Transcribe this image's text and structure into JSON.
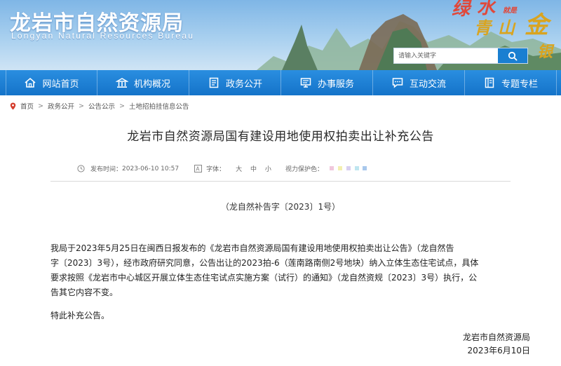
{
  "header": {
    "site_title": "龙岩市自然资源局",
    "site_subtitle": "Longyan Natural Resources Bureau",
    "slogan_chars": [
      "绿",
      "水",
      "就是",
      "青",
      "山",
      "金",
      "银"
    ],
    "search_placeholder": "请输入关键字"
  },
  "nav": {
    "items": [
      {
        "label": "网站首页",
        "icon": "home-icon"
      },
      {
        "label": "机构概况",
        "icon": "building-icon"
      },
      {
        "label": "政务公开",
        "icon": "document-icon"
      },
      {
        "label": "办事服务",
        "icon": "service-icon"
      },
      {
        "label": "互动交流",
        "icon": "chat-icon"
      },
      {
        "label": "专题专栏",
        "icon": "book-icon"
      }
    ]
  },
  "breadcrumb": {
    "items": [
      "首页",
      "政务公开",
      "公告公示",
      "土地招拍挂信息公告"
    ],
    "separator": ">"
  },
  "article": {
    "title": "龙岩市自然资源局国有建设用地使用权拍卖出让补充公告",
    "publish_label": "发布时间：",
    "publish_time": "2023-06-10 10:57",
    "font_label": "字体：",
    "font_sizes": [
      "大",
      "中",
      "小"
    ],
    "vision_label": "视力保护色：",
    "vision_colors": [
      "#f5e6ef",
      "#e6f5e6",
      "#f5f0e0",
      "#e0ecf5",
      "#ffffff"
    ],
    "doc_number": "（龙自然补告字〔2023〕1号）",
    "paragraph1_lines": [
      "我局于2023年5月25日在闽西日报发布的《龙岩市自然资源局国有建设用地使用权拍卖出让公告》（龙自然告",
      "字〔2023〕3号），经市政府研究同意，公告出让的2023拍-6（莲南路南侧2号地块）纳入立体生态住宅试点，具体",
      "要求按照《龙岩市中心城区开展立体生态住宅试点实施方案（试行）的通知》（龙自然资规〔2023〕3号）执行，公",
      "告其它内容不变。"
    ],
    "paragraph2": "特此补充公告。",
    "signature_org": "龙岩市自然资源局",
    "signature_date": "2023年6月10日"
  },
  "colors": {
    "nav_blue": "#1a7fd1",
    "slogan_red": "#e0483a",
    "slogan_gold": "#d9a420"
  }
}
